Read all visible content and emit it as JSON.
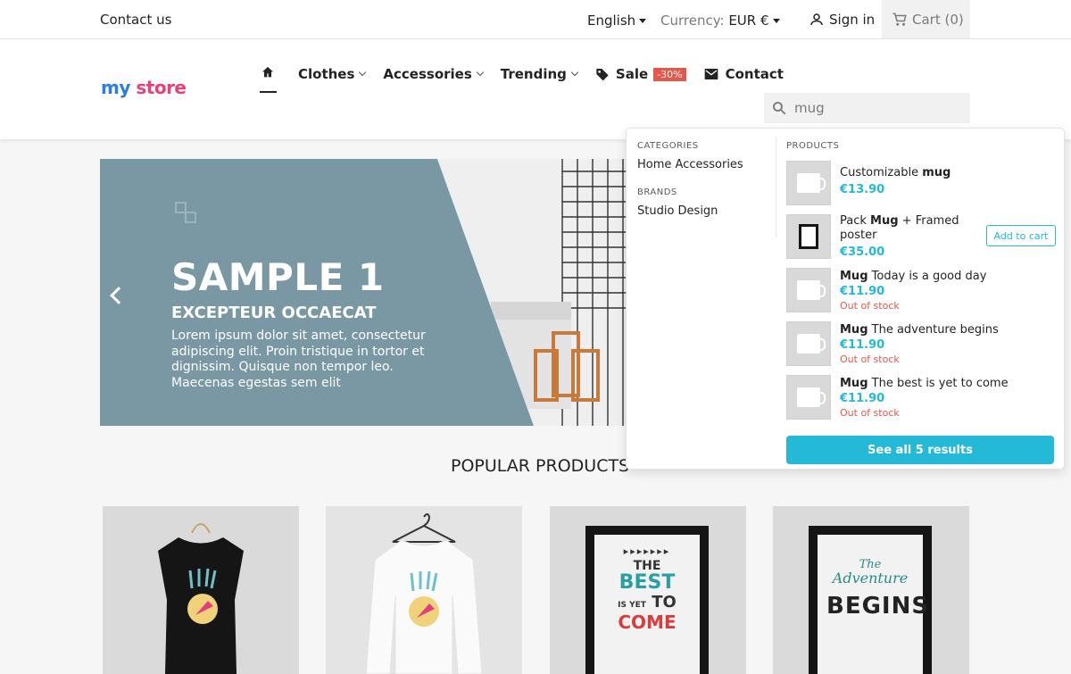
{
  "topbar": {
    "contact": "Contact us",
    "language": "English",
    "currency_label": "Currency:",
    "currency_value": "EUR €",
    "signin": "Sign in",
    "cart": "Cart (0)"
  },
  "header": {
    "logo_my": "my",
    "logo_store": "store",
    "nav": {
      "clothes": "Clothes",
      "accessories": "Accessories",
      "trending": "Trending",
      "sale": "Sale",
      "sale_badge": "-30%",
      "contact": "Contact"
    },
    "search_value": "mug"
  },
  "hero": {
    "title": "SAMPLE 1",
    "subtitle": "EXCEPTEUR OCCAECAT",
    "description": "Lorem ipsum dolor sit amet, consectetur adipiscing elit. Proin tristique in tortor et dignissim. Quisque non tempor leo. Maecenas egestas sem elit"
  },
  "popular_title": "POPULAR PRODUCTS",
  "dropdown": {
    "categories_head": "CATEGORIES",
    "category_link": "Home Accessories",
    "brands_head": "BRANDS",
    "brand_link": "Studio Design",
    "products_head": "PRODUCTS",
    "products": [
      {
        "pre": "Customizable ",
        "bold": "mug",
        "post": "",
        "price": "€13.90",
        "stock": ""
      },
      {
        "pre": "Pack ",
        "bold": "Mug",
        "post": " + Framed poster",
        "price": "€35.00",
        "stock": "",
        "button": "Add to cart"
      },
      {
        "pre": "",
        "bold": "Mug",
        "post": " Today is a good day",
        "price": "€11.90",
        "stock": "Out of stock"
      },
      {
        "pre": "",
        "bold": "Mug",
        "post": " The adventure begins",
        "price": "€11.90",
        "stock": "Out of stock"
      },
      {
        "pre": "",
        "bold": "Mug",
        "post": " The best is yet to come",
        "price": "€11.90",
        "stock": "Out of stock"
      }
    ],
    "see_all": "See all 5 results"
  },
  "poster_text": {
    "best_the": "THE",
    "best_best": "BEST",
    "best_isyet": "IS YET",
    "best_to": "TO",
    "best_come": "COME",
    "adv_the": "The",
    "adv_adventure": "Adventure",
    "adv_begins": "BEGINS"
  },
  "colors": {
    "accent": "#24b9d7",
    "sale": "#e4584c",
    "hero_bg": "#7a98a4"
  }
}
